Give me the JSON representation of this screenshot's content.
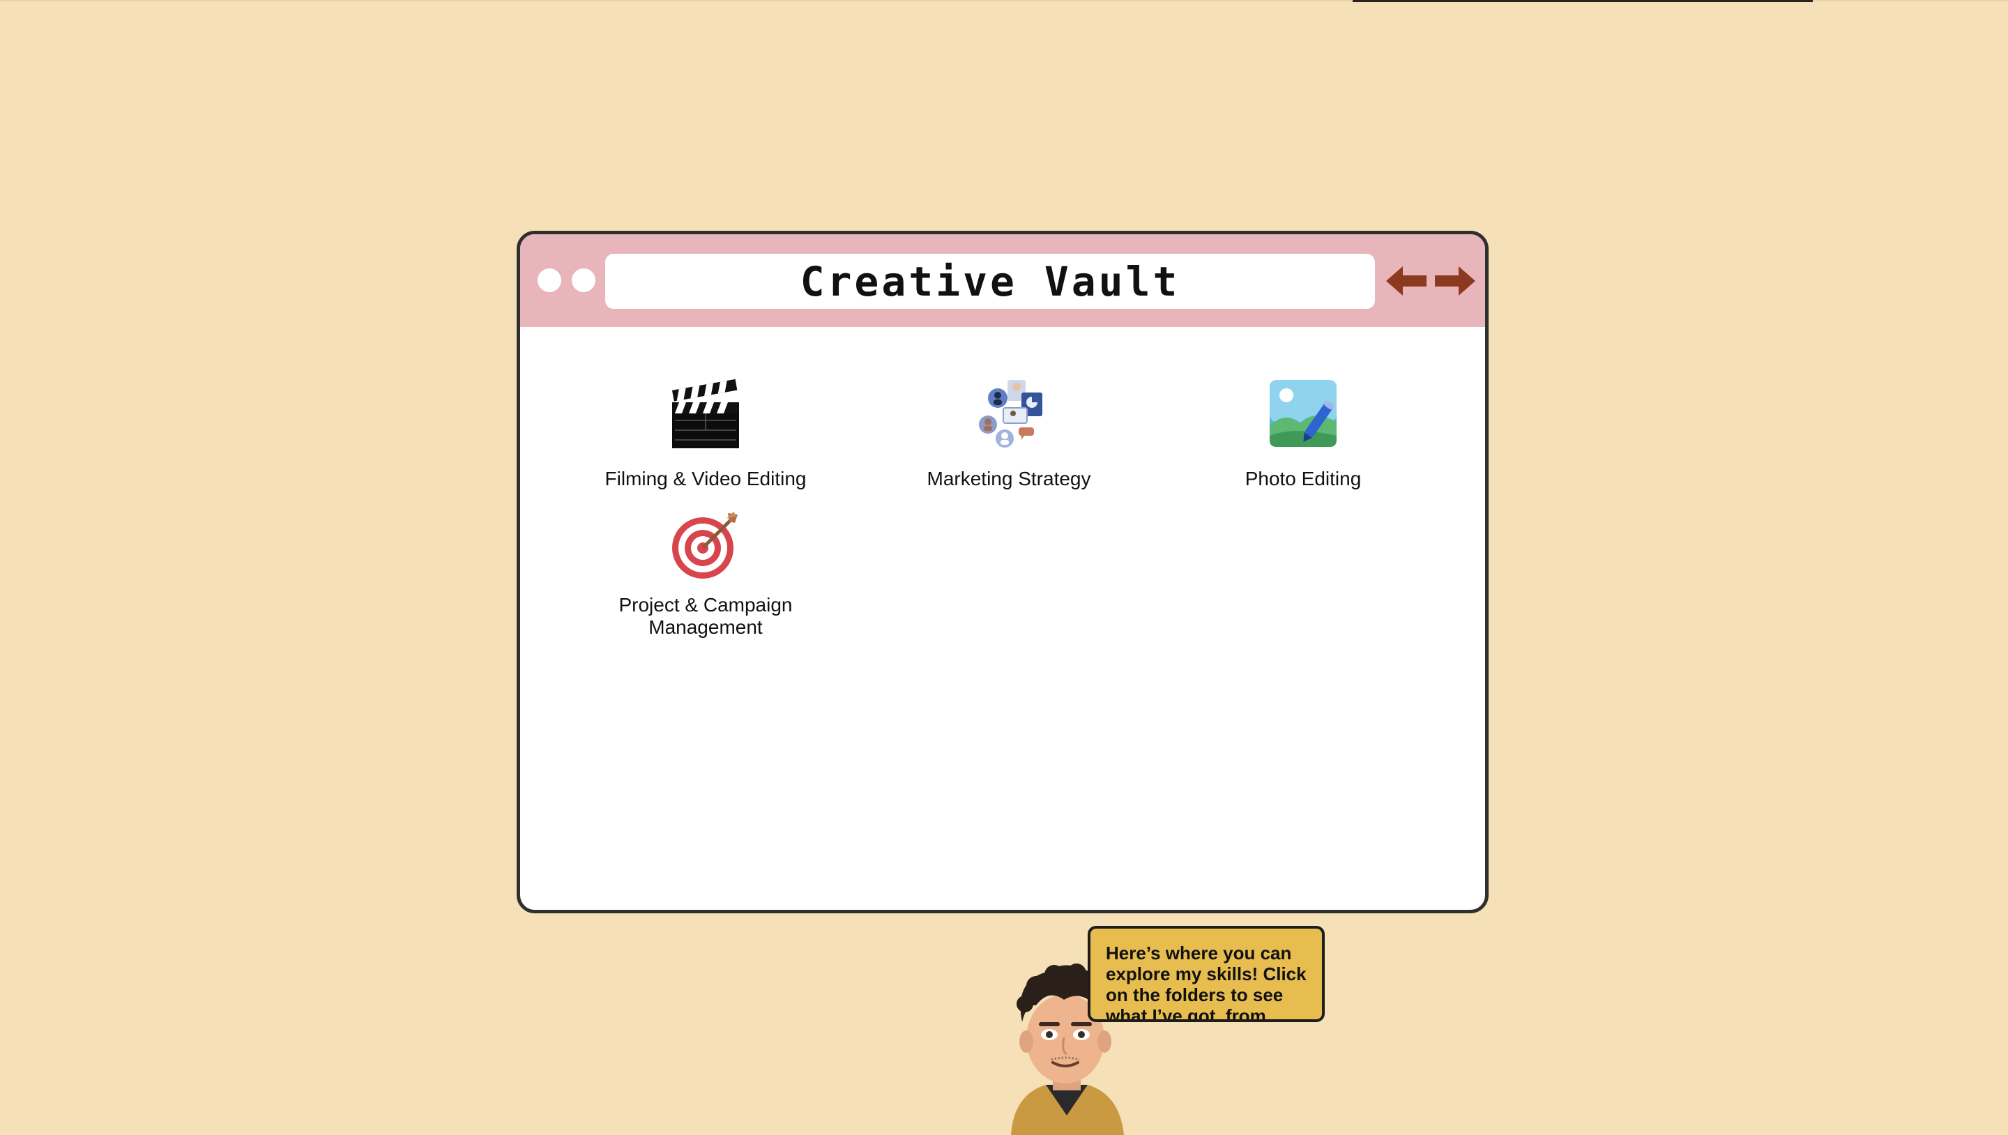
{
  "window": {
    "title": "Creative Vault",
    "nav": {
      "back_icon": "arrow-left-icon",
      "forward_icon": "arrow-right-icon"
    },
    "colors": {
      "titlebar": "#e8b6ba",
      "arrows": "#8b3a1f",
      "background": "#f5e0b7"
    }
  },
  "folders": [
    {
      "label": "Filming & Video Editing",
      "icon": "clapperboard-icon"
    },
    {
      "label": "Marketing Strategy",
      "icon": "marketing-network-icon"
    },
    {
      "label": "Photo Editing",
      "icon": "photo-edit-icon"
    },
    {
      "label_line1": "Project & Campaign",
      "label_line2": "Management",
      "icon": "target-icon"
    }
  ],
  "assistant": {
    "bubble_text": "Here’s where you can explore my skills! Click on the folders to see what I’ve got, from",
    "avatar_icon": "avatar-icon"
  }
}
